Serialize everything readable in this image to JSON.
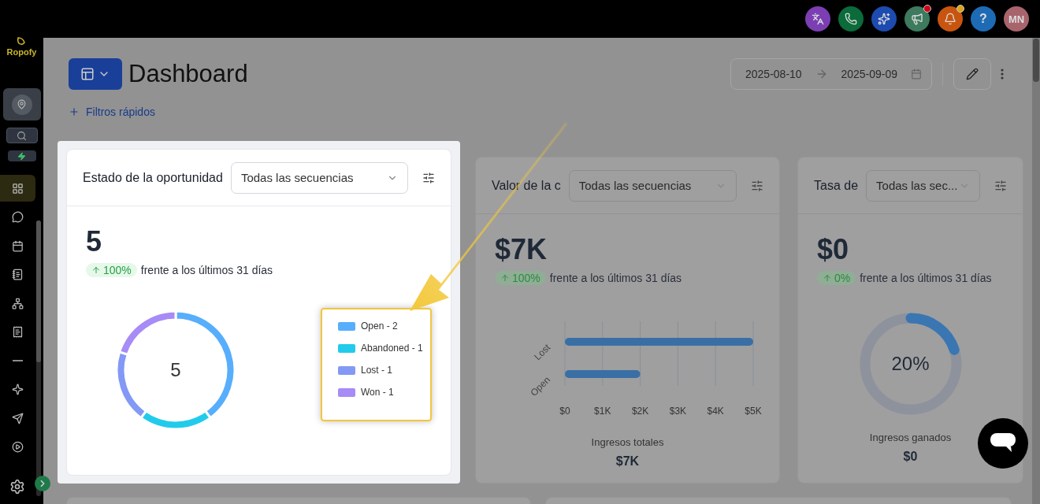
{
  "topbar": {
    "icons": [
      {
        "color": "#7b3fb3",
        "notification": false
      },
      {
        "color": "#0b6b3a",
        "notification": false
      },
      {
        "color": "#1d4bb0",
        "notification": false
      },
      {
        "color": "#3d7a5e",
        "notification": true
      },
      {
        "color": "#c8550f",
        "notification": true
      },
      {
        "label": "?",
        "color": "#1e6bb5",
        "notification": false
      },
      {
        "label": "MN",
        "color": "#a8646c",
        "notification": false
      }
    ]
  },
  "sidebar": {
    "logo": "Ropofy",
    "items": [
      {
        "selected": true
      },
      {
        "selected": false
      },
      {
        "selected": false
      },
      {
        "selected": false
      },
      {
        "selected": false
      },
      {
        "selected": false
      },
      {
        "selected": false
      },
      {
        "selected": false
      },
      {
        "selected": false
      },
      {
        "selected": false
      }
    ]
  },
  "header": {
    "title": "Dashboard",
    "quick_filters": "Filtros rápidos",
    "date_from": "2025-08-10",
    "date_to": "2025-09-09"
  },
  "cards": [
    {
      "kind": "donut",
      "highlighted": true,
      "title": "Estado de la oportunidad",
      "dropdown": "Todas las secuencias",
      "value": "5",
      "change": "100%",
      "comparison": "frente a los últimos 31 días",
      "center": "5",
      "chart_data": {
        "type": "donut",
        "categories": [
          "Open - 2",
          "Abandoned - 1",
          "Lost - 1",
          "Won - 1"
        ],
        "values": [
          40,
          20,
          20,
          20
        ]
      },
      "legend": [
        {
          "color": "#57aefc"
        },
        {
          "color": "#22cbeb"
        },
        {
          "color": "#8399f5"
        },
        {
          "color": "#a78bf6"
        }
      ]
    },
    {
      "kind": "bars",
      "highlighted": false,
      "title": "Valor de la c",
      "dropdown": "Todas las secuencias",
      "value": "$7K",
      "change": "100%",
      "comparison": "frente a los últimos 31 días",
      "caption": "Ingresos totales",
      "total": "$7K",
      "chart_data": {
        "type": "bar",
        "orientation": "horizontal",
        "grid": true,
        "categories": [
          "Lost",
          "Open"
        ],
        "values": [
          5000,
          2000
        ],
        "xlim": [
          0,
          5000
        ],
        "xticks": [
          {
            "value": 0,
            "label": "$0"
          },
          {
            "value": 1000,
            "label": "$1K"
          },
          {
            "value": 2000,
            "label": "$2K"
          },
          {
            "value": 3000,
            "label": "$3K"
          },
          {
            "value": 4000,
            "label": "$4K"
          },
          {
            "value": 5000,
            "label": "$5K"
          }
        ]
      }
    },
    {
      "kind": "gauge",
      "highlighted": false,
      "title": "Tasa de",
      "dropdown": "Todas las sec...",
      "value": "$0",
      "change": "0%",
      "comparison": "frente a los últimos 31 días",
      "level": 0.2,
      "reading": "20%",
      "caption": "Ingresos ganados",
      "total": "$0"
    }
  ]
}
